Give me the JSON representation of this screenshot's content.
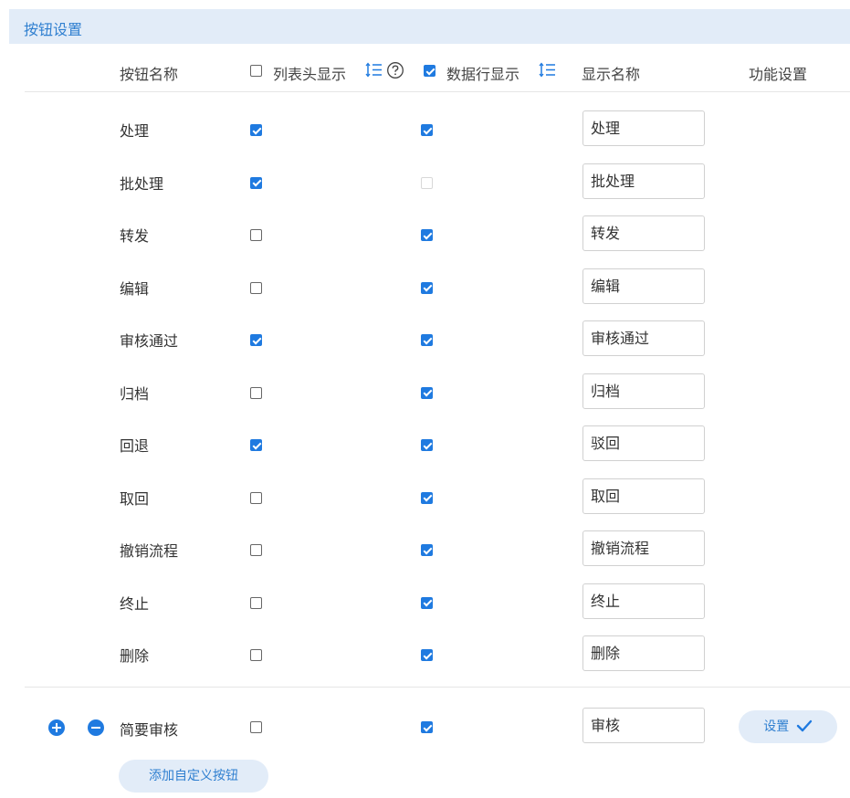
{
  "section": {
    "title": "按钮设置"
  },
  "columns": {
    "name": "按钮名称",
    "list_header": "列表头显示",
    "data_row": "数据行显示",
    "display_name": "显示名称",
    "function": "功能设置"
  },
  "header_checks": {
    "list_header": false,
    "data_row": true
  },
  "rows": [
    {
      "name": "处理",
      "list_header": true,
      "data_row": true,
      "display": "处理"
    },
    {
      "name": "批处理",
      "list_header": true,
      "data_row": "disabled",
      "display": "批处理"
    },
    {
      "name": "转发",
      "list_header": false,
      "data_row": true,
      "display": "转发"
    },
    {
      "name": "编辑",
      "list_header": false,
      "data_row": true,
      "display": "编辑"
    },
    {
      "name": "审核通过",
      "list_header": true,
      "data_row": true,
      "display": "审核通过"
    },
    {
      "name": "归档",
      "list_header": false,
      "data_row": true,
      "display": "归档"
    },
    {
      "name": "回退",
      "list_header": true,
      "data_row": true,
      "display": "驳回"
    },
    {
      "name": "取回",
      "list_header": false,
      "data_row": true,
      "display": "取回"
    },
    {
      "name": "撤销流程",
      "list_header": false,
      "data_row": true,
      "display": "撤销流程"
    },
    {
      "name": "终止",
      "list_header": false,
      "data_row": true,
      "display": "终止"
    },
    {
      "name": "删除",
      "list_header": false,
      "data_row": true,
      "display": "删除"
    }
  ],
  "custom_row": {
    "name": "简要审核",
    "list_header": false,
    "data_row": true,
    "display": "审核",
    "settings_label": "设置"
  },
  "add_button_label": "添加自定义按钮",
  "icons": {
    "sort_list_header": "sort-icon",
    "help": "help-icon",
    "sort_data_row": "sort-icon",
    "add_row": "plus-circle-icon",
    "remove_row": "minus-circle-icon",
    "settings_check": "checkmark-icon"
  },
  "colors": {
    "accent": "#1f7ae0",
    "header_bg": "#e2ecf8",
    "header_text": "#2f7fd0"
  }
}
